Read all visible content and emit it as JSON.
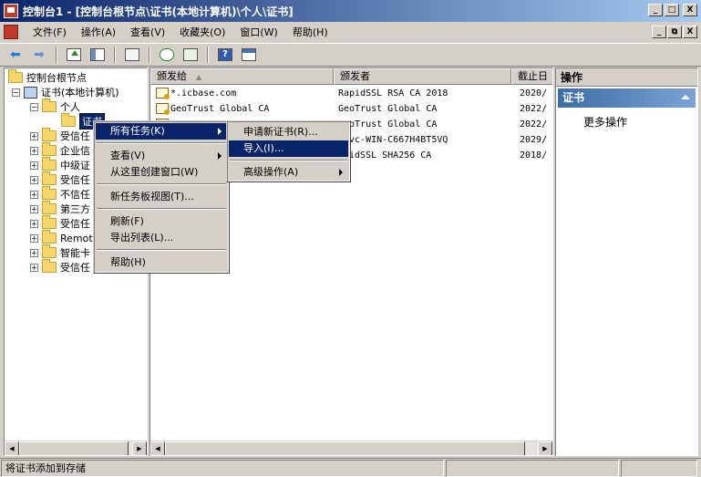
{
  "window": {
    "title": "控制台1 - [控制台根节点\\证书(本地计算机)\\个人\\证书]",
    "btn_min": "_",
    "btn_max": "□",
    "btn_close": "X"
  },
  "mdi": {
    "btn_min": "_",
    "btn_restore": "⧉",
    "btn_close": "X"
  },
  "menubar": [
    "文件(F)",
    "操作(A)",
    "查看(V)",
    "收藏夹(O)",
    "窗口(W)",
    "帮助(H)"
  ],
  "tree": {
    "root": "控制台根节点",
    "certs": "证书(本地计算机)",
    "personal": "个人",
    "personal_certs": "证书",
    "nodes": [
      "受信任",
      "企业信",
      "中级证",
      "受信任",
      "不信任",
      "第三方",
      "受信任",
      "Remot",
      "智能卡",
      "受信任"
    ]
  },
  "list": {
    "columns": [
      "颁发给",
      "颁发者",
      "截止日"
    ],
    "rows": [
      {
        "issued_to": "*.icbase.com",
        "issuer": "RapidSSL RSA CA 2018",
        "expires": "2020/"
      },
      {
        "issued_to": "GeoTrust Global CA",
        "issuer": "GeoTrust Global CA",
        "expires": "2022/"
      },
      {
        "issued_to": "",
        "issuer": "GeoTrust Global CA",
        "expires": "2022/"
      },
      {
        "issued_to": "",
        "issuer": "Svc-WIN-C667H4BT5VQ",
        "expires": "2029/"
      },
      {
        "issued_to": "",
        "issuer": "pidSSL SHA256 CA",
        "expires": "2018/"
      }
    ]
  },
  "actions": {
    "header": "操作",
    "section": "证书",
    "more": "更多操作"
  },
  "context_menu": {
    "items": [
      "所有任务(K)",
      "查看(V)",
      "从这里创建窗口(W)",
      "新任务板视图(T)...",
      "刷新(F)",
      "导出列表(L)...",
      "帮助(H)"
    ]
  },
  "submenu": {
    "items": [
      "申请新证书(R)...",
      "导入(I)...",
      "高级操作(A)"
    ]
  },
  "status": {
    "text": "将证书添加到存储"
  }
}
